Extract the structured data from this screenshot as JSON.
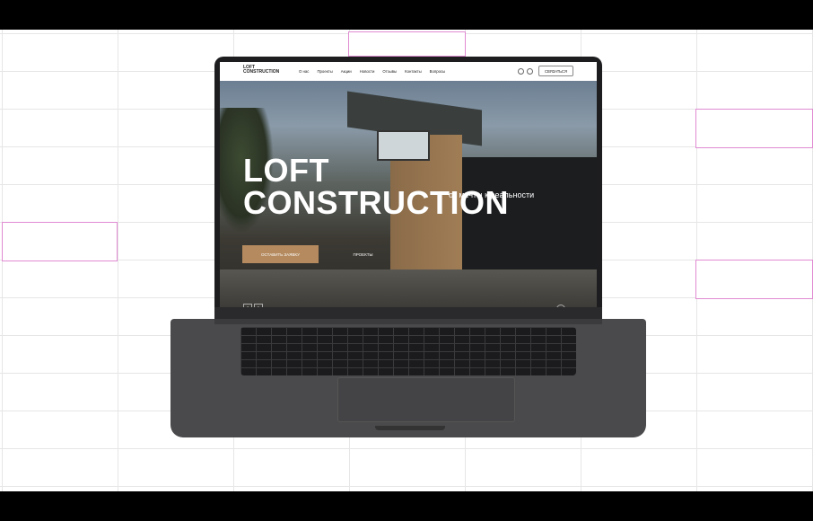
{
  "site": {
    "logo_line1": "LOFT",
    "logo_line2": "CONSTRUCTION",
    "nav": [
      "О нас",
      "Проекты",
      "Акции",
      "Новости",
      "Отзывы",
      "Контакты",
      "Вопросы"
    ],
    "contact_button": "СВЯЗАТЬСЯ",
    "hero_title_line1": "LOFT",
    "hero_title_line2": "CONSTRUCTION",
    "hero_subtitle": "от мечты к реальности",
    "cta_button": "ОСТАВИТЬ ЗАЯВКУ",
    "projects_button": "ПРОЕКТЫ",
    "arrow_prev": "‹",
    "arrow_next": "›"
  },
  "colors": {
    "accent": "#b48a5e",
    "background_grid": "#e6e6e6",
    "highlight_box": "#e08bd2",
    "laptop_body": "#4a4a4c"
  },
  "icons": [
    "telegram-icon",
    "whatsapp-icon",
    "chevron-left-icon",
    "chevron-right-icon",
    "scroll-icon"
  ]
}
